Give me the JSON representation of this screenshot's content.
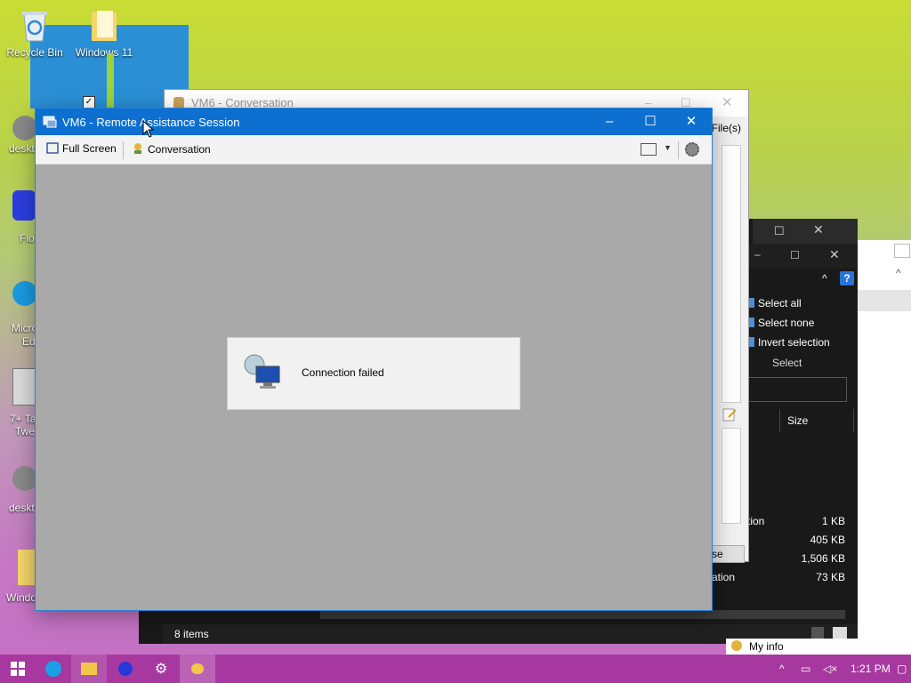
{
  "desktop": {
    "icons": [
      {
        "label": "Recycle Bin",
        "icon": "recycle-bin-icon"
      },
      {
        "label": "Windows 11",
        "icon": "folder-icon"
      }
    ],
    "clipped_labels": [
      "deskt",
      "Flo",
      "Micro",
      "Ed",
      "7+ Ta",
      "Twe",
      "deskt",
      "Windo"
    ]
  },
  "conversation_window": {
    "title": "VM6 - Conversation",
    "files_tab": "File(s)",
    "close_button": "se"
  },
  "explorer_window": {
    "ribbon": {
      "select_all": "Select all",
      "select_none": "Select none",
      "invert_selection": "Invert selection",
      "group_label": "Select"
    },
    "column_size": "Size",
    "rows": [
      {
        "name": "tion",
        "size": "1 KB"
      },
      {
        "name": "",
        "size": "405 KB"
      },
      {
        "name": "",
        "size": "1,506 KB"
      },
      {
        "name": "ation",
        "size": "73 KB"
      }
    ],
    "status_items": "8 items"
  },
  "ra_window": {
    "title": "VM6 - Remote Assistance Session",
    "toolbar": {
      "full_screen": "Full Screen",
      "conversation": "Conversation"
    },
    "dialog_message": "Connection failed"
  },
  "taskbar": {
    "time": "1:21 PM",
    "my_info": "My info"
  }
}
